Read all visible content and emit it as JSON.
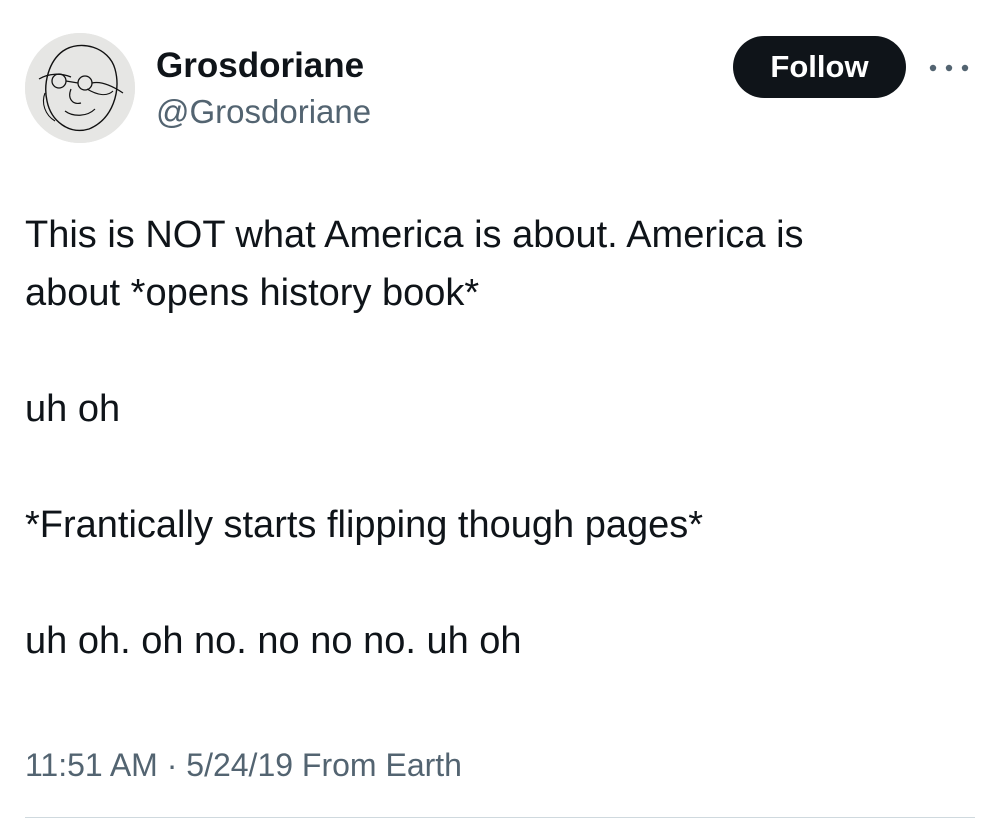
{
  "author": {
    "display_name": "Grosdoriane",
    "handle": "@Grosdoriane",
    "avatar_icon": "line-drawing-face-avatar"
  },
  "actions": {
    "follow_label": "Follow",
    "more_icon": "more-horizontal-icon"
  },
  "tweet": {
    "paragraphs": [
      "This is NOT what America is about. America is\nabout *opens history book*",
      "uh oh",
      "*Frantically starts flipping though pages*",
      "uh oh. oh no. no no no. uh oh"
    ]
  },
  "meta": {
    "time": "11:51 AM",
    "separator": "·",
    "date": "5/24/19",
    "source": "From Earth"
  },
  "colors": {
    "text": "#0f1419",
    "secondary": "#536471",
    "button_bg": "#0f1419",
    "divider": "#cfd9de"
  }
}
